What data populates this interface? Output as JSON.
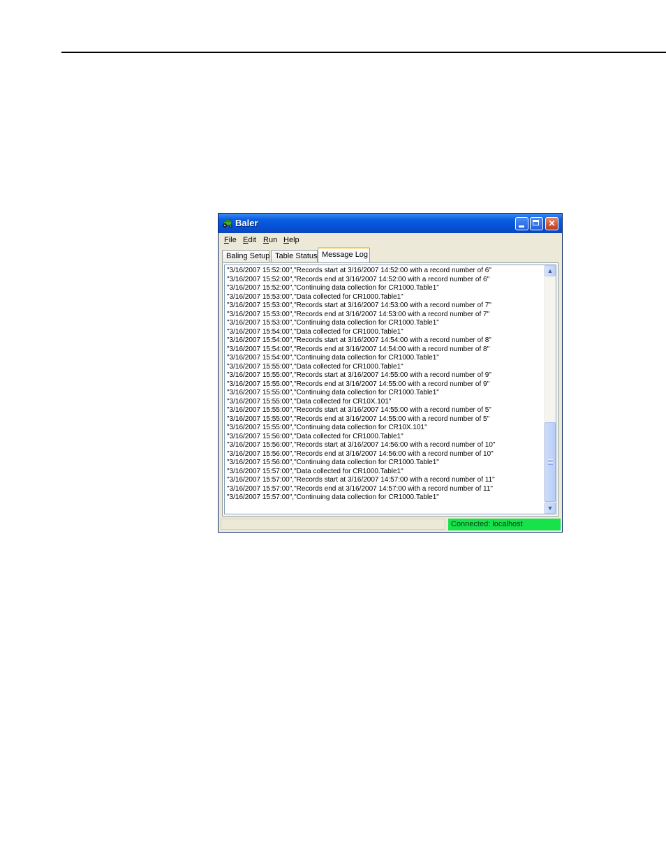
{
  "window": {
    "title": "Baler",
    "status": {
      "connection": "Connected: localhost",
      "connection_color": "#16e34a"
    }
  },
  "menu": [
    {
      "mnemonic": "F",
      "rest": "ile"
    },
    {
      "mnemonic": "E",
      "rest": "dit"
    },
    {
      "mnemonic": "R",
      "rest": "un"
    },
    {
      "mnemonic": "H",
      "rest": "elp"
    }
  ],
  "tabs": [
    {
      "label": "Baling Setup",
      "active": false
    },
    {
      "label": "Table Status",
      "active": false
    },
    {
      "label": "Message Log",
      "active": true
    }
  ],
  "log": [
    "\"3/16/2007 15:52:00\",\"Records start at 3/16/2007 14:52:00 with a record number of 6\"",
    "\"3/16/2007 15:52:00\",\"Records end at 3/16/2007 14:52:00 with a record number of 6\"",
    "\"3/16/2007 15:52:00\",\"Continuing data collection for CR1000.Table1\"",
    "\"3/16/2007 15:53:00\",\"Data collected for CR1000.Table1\"",
    "\"3/16/2007 15:53:00\",\"Records start at 3/16/2007 14:53:00 with a record number of 7\"",
    "\"3/16/2007 15:53:00\",\"Records end at 3/16/2007 14:53:00 with a record number of 7\"",
    "\"3/16/2007 15:53:00\",\"Continuing data collection for CR1000.Table1\"",
    "\"3/16/2007 15:54:00\",\"Data collected for CR1000.Table1\"",
    "\"3/16/2007 15:54:00\",\"Records start at 3/16/2007 14:54:00 with a record number of 8\"",
    "\"3/16/2007 15:54:00\",\"Records end at 3/16/2007 14:54:00 with a record number of 8\"",
    "\"3/16/2007 15:54:00\",\"Continuing data collection for CR1000.Table1\"",
    "\"3/16/2007 15:55:00\",\"Data collected for CR1000.Table1\"",
    "\"3/16/2007 15:55:00\",\"Records start at 3/16/2007 14:55:00 with a record number of 9\"",
    "\"3/16/2007 15:55:00\",\"Records end at 3/16/2007 14:55:00 with a record number of 9\"",
    "\"3/16/2007 15:55:00\",\"Continuing data collection for CR1000.Table1\"",
    "\"3/16/2007 15:55:00\",\"Data collected for CR10X.101\"",
    "\"3/16/2007 15:55:00\",\"Records start at 3/16/2007 14:55:00 with a record number of 5\"",
    "\"3/16/2007 15:55:00\",\"Records end at 3/16/2007 14:55:00 with a record number of 5\"",
    "\"3/16/2007 15:55:00\",\"Continuing data collection for CR10X.101\"",
    "\"3/16/2007 15:56:00\",\"Data collected for CR1000.Table1\"",
    "\"3/16/2007 15:56:00\",\"Records start at 3/16/2007 14:56:00 with a record number of 10\"",
    "\"3/16/2007 15:56:00\",\"Records end at 3/16/2007 14:56:00 with a record number of 10\"",
    "\"3/16/2007 15:56:00\",\"Continuing data collection for CR1000.Table1\"",
    "\"3/16/2007 15:57:00\",\"Data collected for CR1000.Table1\"",
    "\"3/16/2007 15:57:00\",\"Records start at 3/16/2007 14:57:00 with a record number of 11\"",
    "\"3/16/2007 15:57:00\",\"Records end at 3/16/2007 14:57:00 with a record number of 11\"",
    "\"3/16/2007 15:57:00\",\"Continuing data collection for CR1000.Table1\""
  ],
  "icons": {
    "app": "tractor-icon",
    "minimize": "minimize-icon",
    "maximize": "maximize-icon",
    "close": "close-icon",
    "scroll_up": "chevron-up-icon",
    "scroll_down": "chevron-down-icon"
  }
}
